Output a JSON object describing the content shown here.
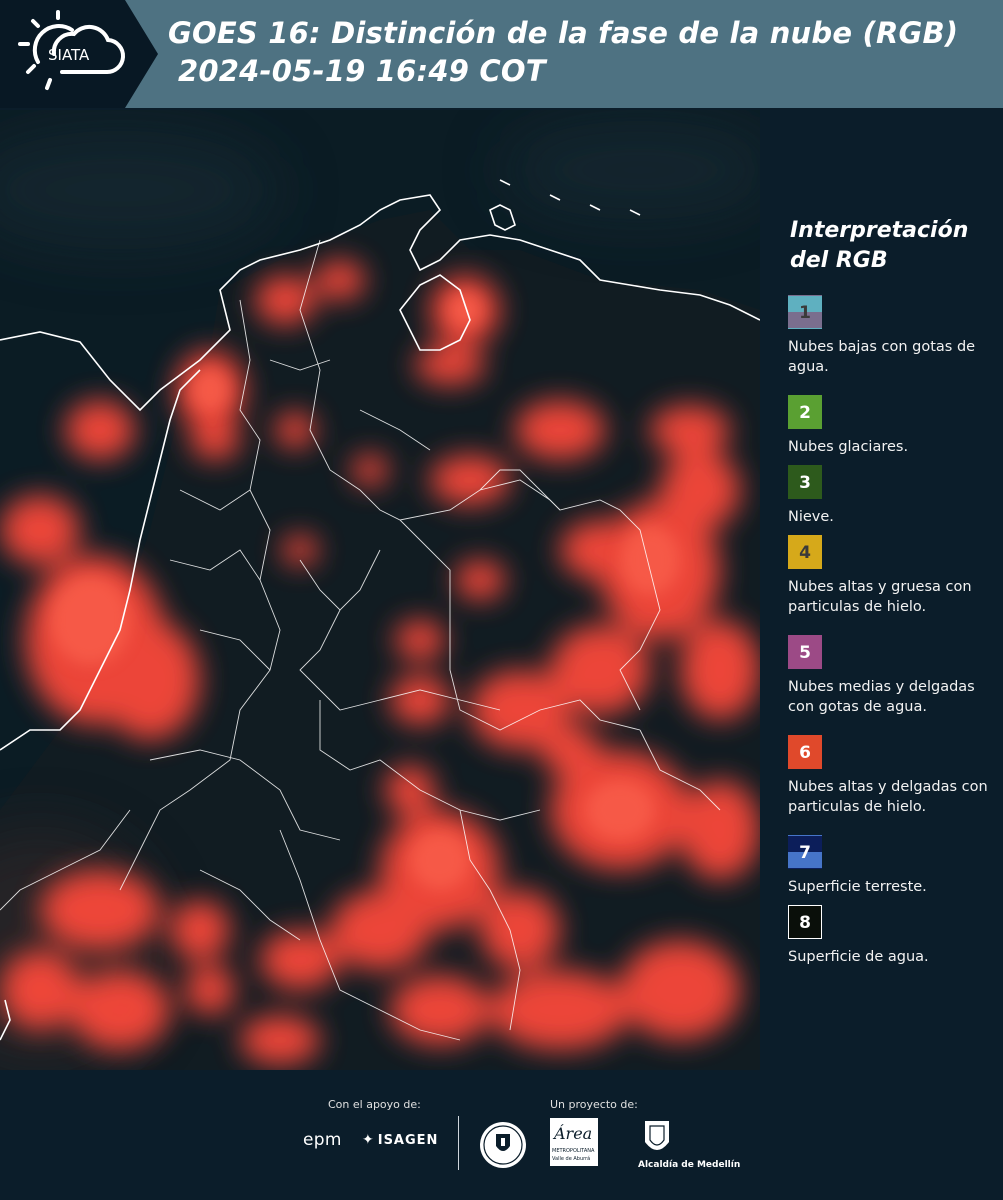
{
  "header": {
    "logo_text": "SIATA",
    "title": "GOES 16: Distinción de la fase de la nube (RGB)",
    "datetime": "2024-05-19 16:49 COT"
  },
  "legend": {
    "title_line1": "Interpretación",
    "title_line2": "del RGB",
    "items": [
      {
        "num": "1",
        "label": "Nubes bajas con gotas de agua.",
        "color_top": "#5fb0c0",
        "color_bottom": "#7a6e8e",
        "num_color": "#3a3a3a"
      },
      {
        "num": "2",
        "label": "Nubes glaciares.",
        "color_top": "#5aa032",
        "color_bottom": "#5aa032",
        "num_color": "#ffffff"
      },
      {
        "num": "3",
        "label": "Nieve.",
        "color_top": "#2d5a1c",
        "color_bottom": "#2d5a1c",
        "num_color": "#ffffff"
      },
      {
        "num": "4",
        "label": "Nubes altas y gruesa con particulas de hielo.",
        "color_top": "#d6a91a",
        "color_bottom": "#d6a91a",
        "num_color": "#3a3a3a"
      },
      {
        "num": "5",
        "label": "Nubes medias y delgadas con gotas de agua.",
        "color_top": "#9c4a86",
        "color_bottom": "#9c4a86",
        "num_color": "#ffffff"
      },
      {
        "num": "6",
        "label": "Nubes altas y delgadas con particulas de hielo.",
        "color_top": "#e0492b",
        "color_bottom": "#e0492b",
        "num_color": "#ffffff"
      },
      {
        "num": "7",
        "label": "Superficie terreste.",
        "color_top": "#0c1e5a",
        "color_bottom": "#4674c8",
        "num_color": "#ffffff"
      },
      {
        "num": "8",
        "label": "Superficie de agua.",
        "color_top": "#0a0f0a",
        "color_bottom": "#0a0f0a",
        "num_color": "#ffffff"
      }
    ]
  },
  "footer": {
    "support_label": "Con el apoyo de:",
    "project_label": "Un proyecto de:",
    "epm_text": "epm",
    "isagen_text": "ISAGEN",
    "area_text": "Área",
    "area_sub1": "METROPOLITANA",
    "area_sub2": "Valle de Aburrá",
    "medellin_text": "Alcaldía de Medellín"
  },
  "colors": {
    "header_band": "#4e7282",
    "background": "#0b1d2a",
    "cloud_red": "#ff4a3a"
  }
}
